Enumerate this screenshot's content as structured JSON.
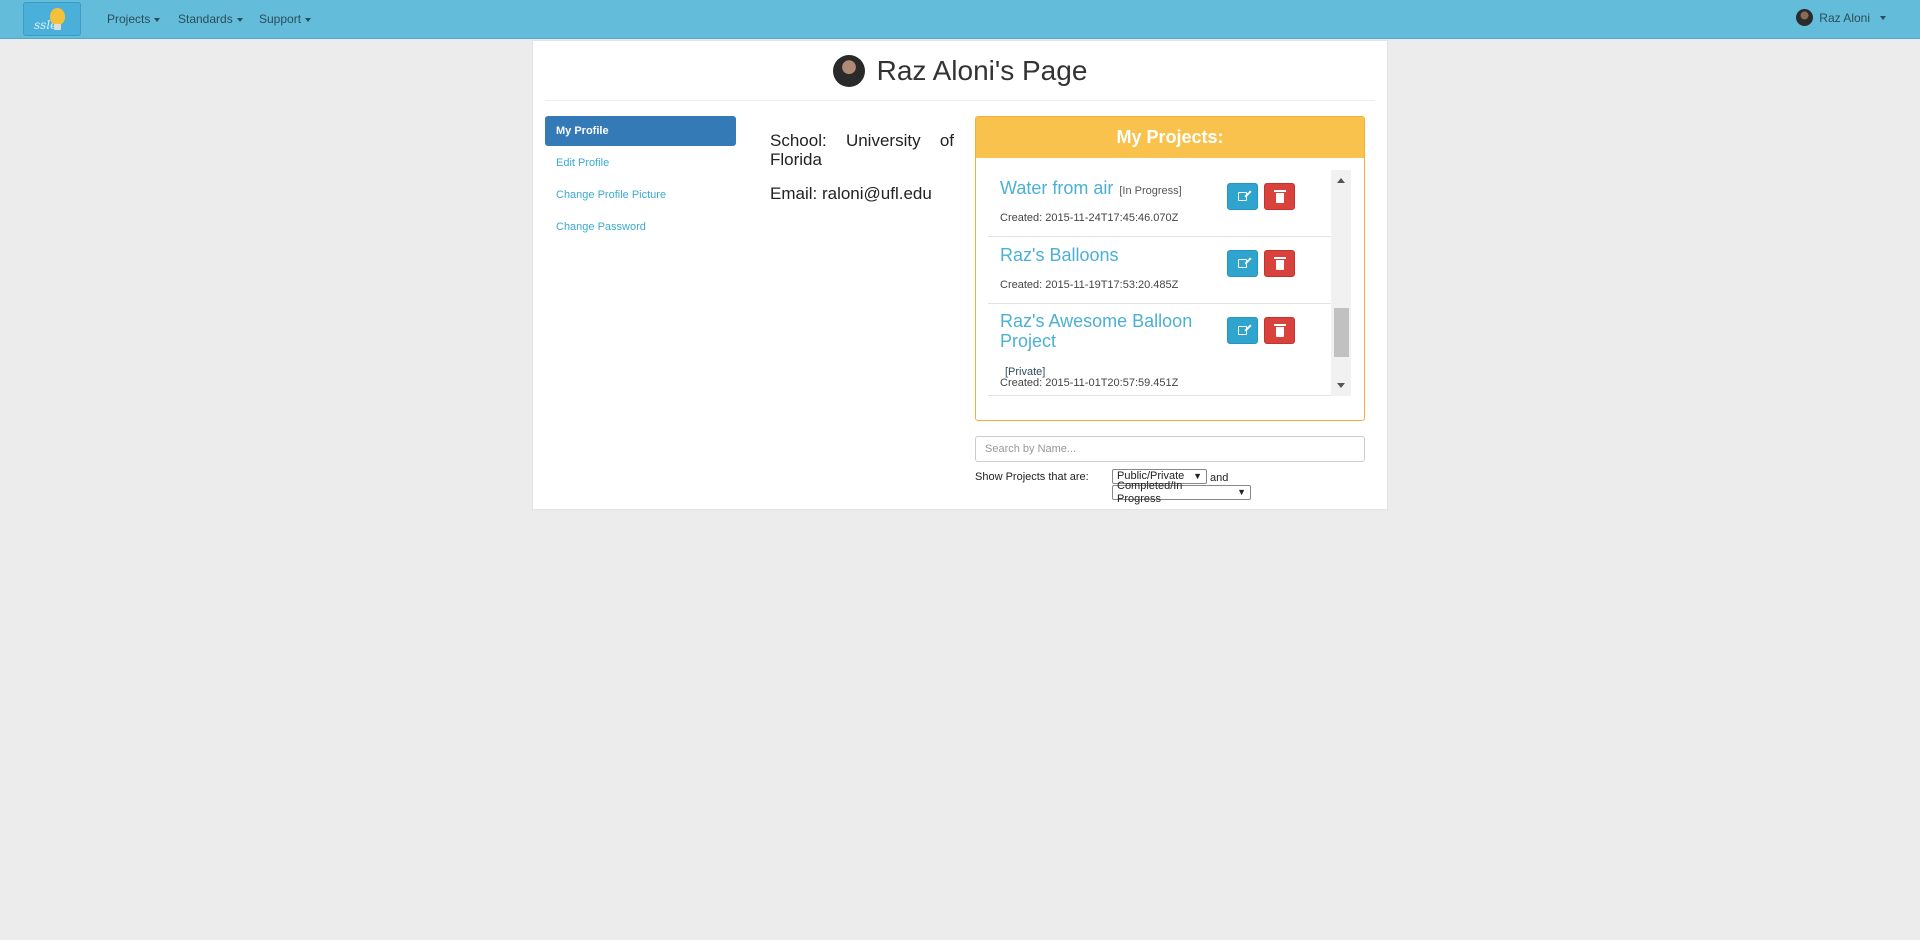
{
  "navbar": {
    "brand_text": "ssle",
    "items": [
      {
        "label": "Projects"
      },
      {
        "label": "Standards"
      },
      {
        "label": "Support"
      }
    ],
    "user": {
      "name": "Raz Aloni"
    }
  },
  "header": {
    "title": "Raz Aloni's Page"
  },
  "sidebar": {
    "items": [
      {
        "label": "My Profile",
        "active": true
      },
      {
        "label": "Edit Profile"
      },
      {
        "label": "Change Profile Picture"
      },
      {
        "label": "Change Password"
      }
    ]
  },
  "profile": {
    "school": "School: University of Florida",
    "email": "Email: raloni@ufl.edu"
  },
  "projects": {
    "heading": "My Projects:",
    "items": [
      {
        "title": "Water from air",
        "tag": "[In Progress]",
        "created": "Created: 2015-11-24T17:45:46.070Z"
      },
      {
        "title": "Raz's Balloons",
        "tag": "",
        "created": "Created: 2015-11-19T17:53:20.485Z"
      },
      {
        "title": "Raz's Awesome Balloon Project",
        "tag": "[Private]",
        "created": "Created: 2015-11-01T20:57:59.451Z"
      }
    ]
  },
  "filters": {
    "search_placeholder": "Search by Name...",
    "show_label": "Show Projects that are:",
    "visibility_value": "Public/Private",
    "and_text": "and",
    "status_value": "Completed/In Progress"
  },
  "colors": {
    "navbar": "#63bcd9",
    "active_nav": "#337ab7",
    "projects_header": "#f8c24c",
    "edit_button": "#2fa4cf",
    "delete_button": "#d9413d",
    "link": "#4bb0d4"
  },
  "icons": [
    "lightbulb-logo-icon",
    "caret-down-icon",
    "edit-icon",
    "trash-icon",
    "scroll-up-icon",
    "scroll-down-icon"
  ]
}
